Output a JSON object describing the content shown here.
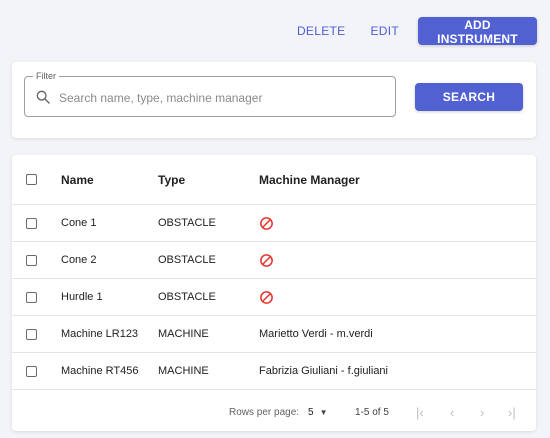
{
  "toolbar": {
    "delete_label": "DELETE",
    "edit_label": "EDIT",
    "add_label": "ADD INSTRUMENT"
  },
  "filter": {
    "legend": "Filter",
    "placeholder": "Search name, type, machine manager",
    "value": "",
    "search_label": "SEARCH",
    "icon": "search-icon"
  },
  "table": {
    "headers": {
      "name": "Name",
      "type": "Type",
      "manager": "Machine Manager"
    },
    "rows": [
      {
        "name": "Cone 1",
        "type": "OBSTACLE",
        "manager": "",
        "manager_icon": "not-allowed-icon"
      },
      {
        "name": "Cone 2",
        "type": "OBSTACLE",
        "manager": "",
        "manager_icon": "not-allowed-icon"
      },
      {
        "name": "Hurdle 1",
        "type": "OBSTACLE",
        "manager": "",
        "manager_icon": "not-allowed-icon"
      },
      {
        "name": "Machine LR123",
        "type": "MACHINE",
        "manager": "Marietto Verdi - m.verdi"
      },
      {
        "name": "Machine RT456",
        "type": "MACHINE",
        "manager": "Fabrizia Giuliani - f.giuliani"
      }
    ]
  },
  "pagination": {
    "rows_per_page_label": "Rows per page:",
    "rows_per_page": "5",
    "range": "1-5 of 5",
    "first_icon": "first-page-icon",
    "prev_icon": "chevron-left-icon",
    "next_icon": "chevron-right-icon",
    "last_icon": "last-page-icon"
  },
  "colors": {
    "primary": "#5161d1",
    "link": "#4f5bd5",
    "blocked": "#e53935",
    "background": "#f3f4f8"
  }
}
